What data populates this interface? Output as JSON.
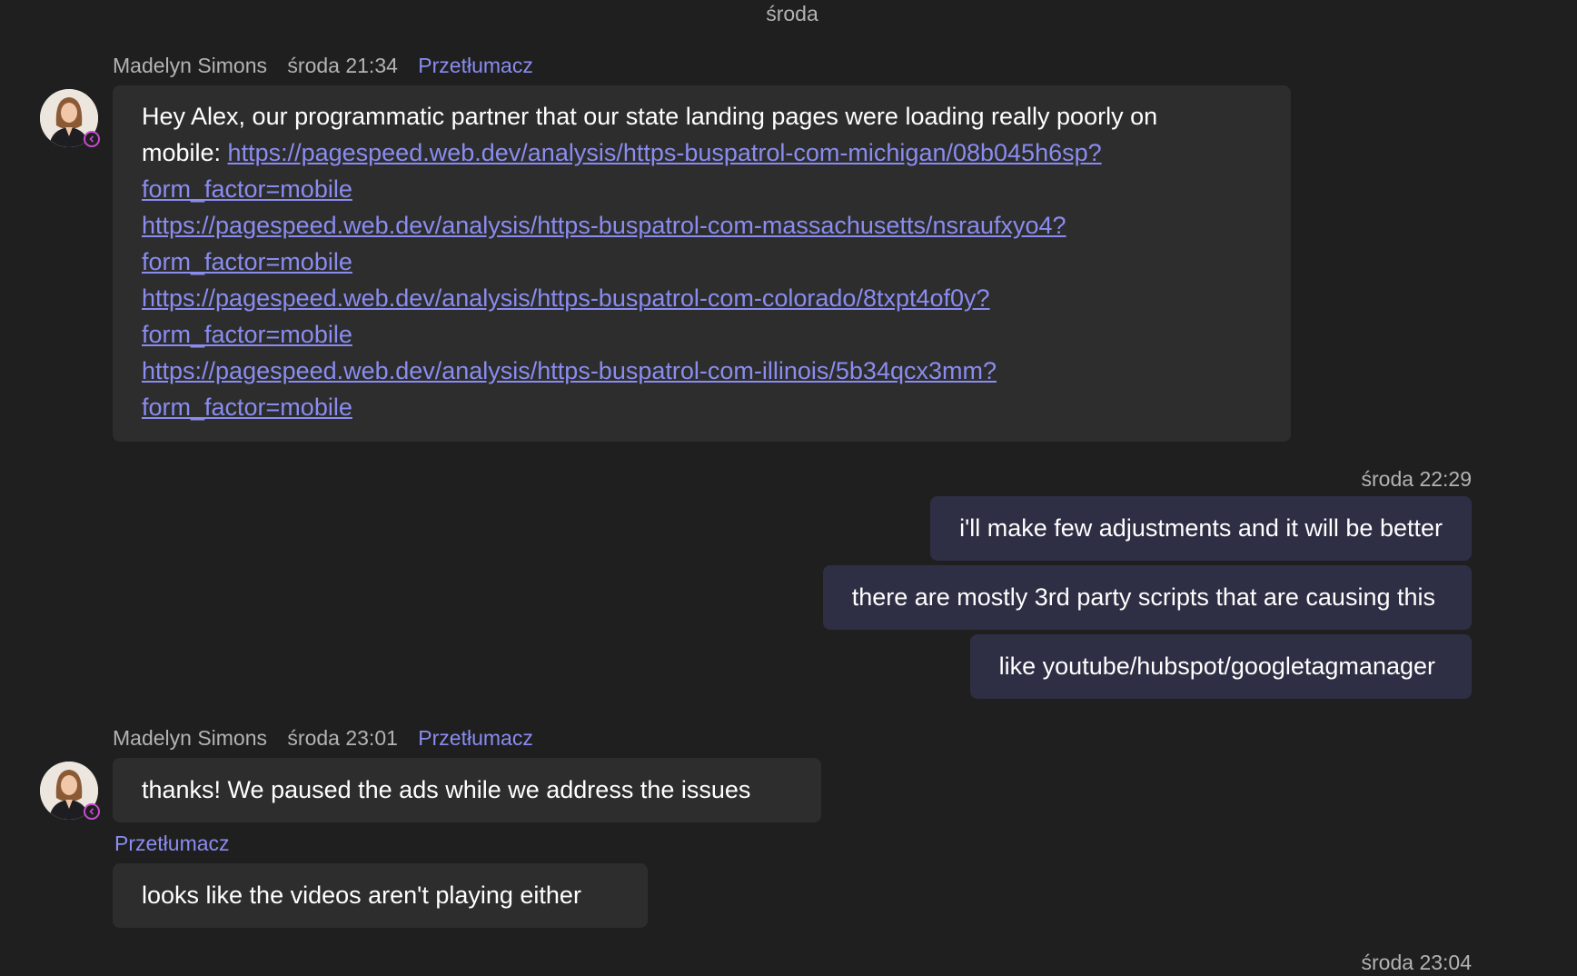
{
  "day_divider": "środa",
  "colors": {
    "background": "#1f1f1f",
    "incoming_bubble": "#2d2d2d",
    "outgoing_bubble": "#2e2e44",
    "link": "#8a8cf0",
    "meta_text": "#b3b3b3",
    "status_ring": "#c64bd1"
  },
  "msg1": {
    "sender": "Madelyn Simons",
    "time": "środa 21:34",
    "translate": "Przetłumacz",
    "text_line1": "Hey Alex, our programmatic partner that our state landing pages were loading really poorly on",
    "text_line2_prefix": "mobile: ",
    "link1_part1": "https://pagespeed.web.dev/analysis/https-buspatrol-com-michigan/08b045h6sp?",
    "link1_part2": "form_factor=mobile",
    "link2_part1": "https://pagespeed.web.dev/analysis/https-buspatrol-com-massachusetts/nsraufxyo4?",
    "link2_part2": "form_factor=mobile",
    "link3_part1": "https://pagespeed.web.dev/analysis/https-buspatrol-com-colorado/8txpt4of0y?",
    "link3_part2": "form_factor=mobile",
    "link4_part1": "https://pagespeed.web.dev/analysis/https-buspatrol-com-illinois/5b34qcx3mm?",
    "link4_part2": "form_factor=mobile"
  },
  "outgoing": {
    "time": "środa 22:29",
    "messages": [
      "i'll make few adjustments and it will be better",
      "there are mostly 3rd party scripts that are causing this",
      "like youtube/hubspot/googletagmanager"
    ]
  },
  "msg2": {
    "sender": "Madelyn Simons",
    "time": "środa 23:01",
    "translate": "Przetłumacz",
    "text": "thanks! We paused the ads while we address the issues"
  },
  "msg3": {
    "translate": "Przetłumacz",
    "text": "looks like the videos aren't playing either"
  },
  "bottom_time_partial": "środa 23:04"
}
